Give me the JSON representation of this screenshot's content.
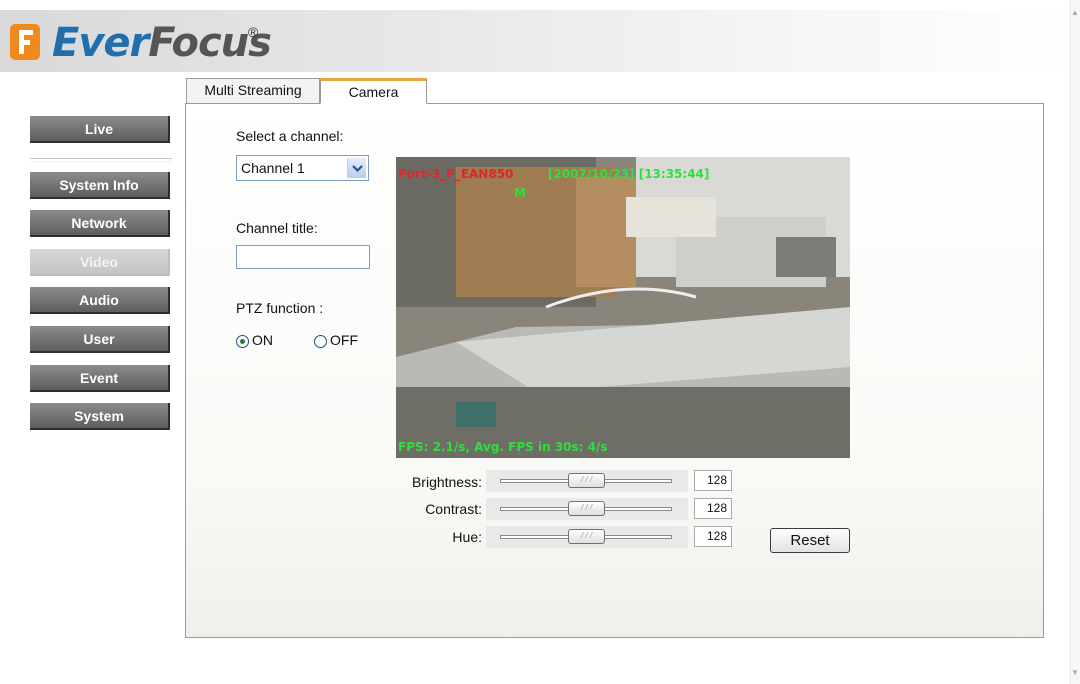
{
  "brand": {
    "name_a": "Ever",
    "name_b": "Focus",
    "registered": "®"
  },
  "sidebar": {
    "items": [
      {
        "label": "Live"
      },
      {
        "label": "System Info"
      },
      {
        "label": "Network"
      },
      {
        "label": "Video"
      },
      {
        "label": "Audio"
      },
      {
        "label": "User"
      },
      {
        "label": "Event"
      },
      {
        "label": "System"
      }
    ],
    "active": "Video"
  },
  "tabs": [
    {
      "label": "Multi Streaming"
    },
    {
      "label": "Camera"
    }
  ],
  "active_tab": "Camera",
  "form": {
    "select_channel_label": "Select a channel:",
    "channel_value": "Channel 1",
    "channel_title_label": "Channel title:",
    "channel_title_value": "",
    "ptz_label": "PTZ function :",
    "ptz_on": "ON",
    "ptz_off": "OFF",
    "ptz_selected": "ON"
  },
  "video": {
    "overlay_name": "Port-3_P_EAN850",
    "overlay_datetime": "[2007/10/23] [13:35:44]",
    "overlay_mode": "M",
    "overlay_fps": "FPS: 2.1/s, Avg. FPS in 30s: 4/s"
  },
  "adjust": [
    {
      "label": "Brightness:",
      "value": "128"
    },
    {
      "label": "Contrast:",
      "value": "128"
    },
    {
      "label": "Hue:",
      "value": "128"
    }
  ],
  "reset_label": "Reset"
}
